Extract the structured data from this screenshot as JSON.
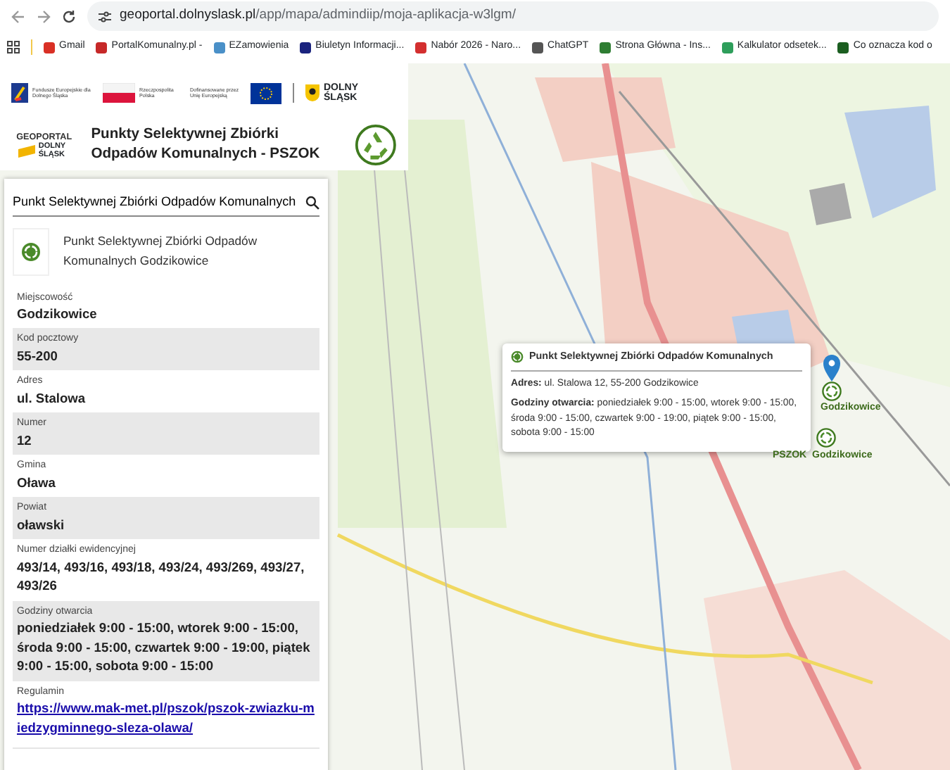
{
  "browser": {
    "url_host": "geoportal.dolnyslask.pl",
    "url_path": "/app/mapa/admindiip/moja-aplikacja-w3lgm/",
    "bookmarks": [
      {
        "label": "Gmail",
        "color": "#d93025"
      },
      {
        "label": "PortalKomunalny.pl -",
        "color": "#c62828"
      },
      {
        "label": "EZamowienia",
        "color": "#4a90c8"
      },
      {
        "label": "Biuletyn Informacji...",
        "color": "#1a237e"
      },
      {
        "label": "Nabór 2026 - Naro...",
        "color": "#d32f2f"
      },
      {
        "label": "ChatGPT",
        "color": "#555555"
      },
      {
        "label": "Strona Główna - Ins...",
        "color": "#2e7d32"
      },
      {
        "label": "Kalkulator odsetek...",
        "color": "#2e9e5b"
      },
      {
        "label": "Co oznacza kod o",
        "color": "#1b5e20"
      }
    ]
  },
  "header": {
    "logos": [
      "Fundusze Europejskie dla Dolnego Śląska",
      "Rzeczpospolita Polska",
      "Dofinansowane przez Unię Europejską"
    ],
    "region_logo": "DOLNY ŚLĄSK",
    "geoportal": "GEOPORTAL",
    "geoportal_sub": "DOLNY ŚLĄSK",
    "title": "Punkty Selektywnej Zbiórki Odpadów Komunalnych - PSZOK"
  },
  "sidebar": {
    "search": {
      "value": "Punkt Selektywnej Zbiórki Odpadów Komunalnych"
    },
    "result_title": "Punkt Selektywnej Zbiórki Odpadów Komunalnych Godzikowice",
    "fields": [
      {
        "label": "Miejscowość",
        "value": "Godzikowice",
        "kind": "text"
      },
      {
        "label": "Kod pocztowy",
        "value": "55-200",
        "kind": "text"
      },
      {
        "label": "Adres",
        "value": "ul. Stalowa",
        "kind": "text"
      },
      {
        "label": "Numer",
        "value": "12",
        "kind": "text"
      },
      {
        "label": "Gmina",
        "value": "Oława",
        "kind": "text"
      },
      {
        "label": "Powiat",
        "value": "oławski",
        "kind": "text"
      },
      {
        "label": "Numer działki ewidencyjnej",
        "value": "493/14, 493/16, 493/18, 493/24, 493/269, 493/27, 493/26",
        "kind": "text"
      },
      {
        "label": "Godziny otwarcia",
        "value": "poniedziałek 9:00 - 15:00, wtorek 9:00 - 15:00, środa 9:00 - 15:00, czwartek 9:00 - 19:00, piątek 9:00 - 15:00, sobota 9:00 - 15:00",
        "kind": "text"
      },
      {
        "label": "Regulamin",
        "value": "https://www.mak-met.pl/pszok/pszok-zwiazku-miedzygminnego-sleza-olawa/",
        "kind": "link"
      }
    ]
  },
  "popup": {
    "title": "Punkt Selektywnej Zbiórki Odpadów Komunalnych",
    "lines": [
      {
        "label": "Adres:",
        "value": "ul. Stalowa 12, 55-200 Godzikowice"
      },
      {
        "label": "Godziny otwarcia:",
        "value": "poniedziałek 9:00 - 15:00, wtorek 9:00 - 15:00, środa 9:00 - 15:00, czwartek 9:00 - 19:00, piątek 9:00 - 15:00, sobota 9:00 - 15:00"
      }
    ]
  },
  "markers": [
    {
      "label": "Godzikowice",
      "selected": true
    },
    {
      "label": "PSZOK  Godzikowice",
      "selected": false
    }
  ]
}
